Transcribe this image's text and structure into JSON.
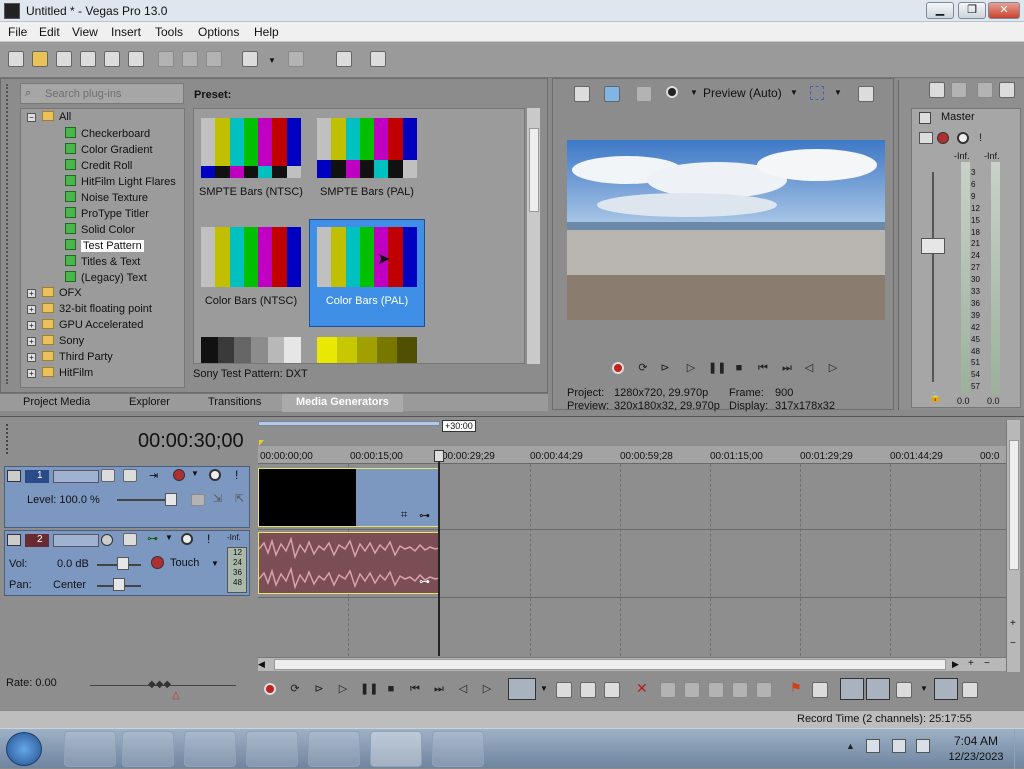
{
  "window": {
    "title": "Untitled * - Vegas Pro 13.0",
    "min": "▁",
    "max": "❐",
    "close": "✕"
  },
  "menu": [
    "File",
    "Edit",
    "View",
    "Insert",
    "Tools",
    "Options",
    "Help"
  ],
  "toolbar_icons": [
    "new-icon",
    "open-icon",
    "save-icon",
    "save-as-icon",
    "render-icon",
    "properties-icon",
    "cut-icon",
    "copy-icon",
    "paste-icon",
    "undo-icon",
    "redo-icon",
    "clean-icon",
    "help-icon"
  ],
  "plugins": {
    "search_placeholder": "Search plug-ins",
    "preset_label": "Preset:",
    "tree_root": "All",
    "generators": [
      "Checkerboard",
      "Color Gradient",
      "Credit Roll",
      "HitFilm Light Flares",
      "Noise Texture",
      "ProType Titler",
      "Solid Color",
      "Test Pattern",
      "Titles & Text",
      "(Legacy) Text"
    ],
    "folders": [
      "OFX",
      "32-bit floating point",
      "GPU Accelerated",
      "Sony",
      "Third Party",
      "HitFilm"
    ],
    "selected_generator": "Test Pattern"
  },
  "presets": [
    {
      "label": "SMPTE Bars (NTSC)"
    },
    {
      "label": "SMPTE Bars (PAL)"
    },
    {
      "label": "Color Bars (NTSC)"
    },
    {
      "label": "Color Bars (PAL)",
      "selected": true
    }
  ],
  "preset_status": "Sony Test Pattern: DXT",
  "tabs": [
    {
      "label": "Project Media"
    },
    {
      "label": "Explorer"
    },
    {
      "label": "Transitions"
    },
    {
      "label": "Media Generators",
      "active": true
    }
  ],
  "preview": {
    "mode": "Preview (Auto)",
    "project_label": "Project:",
    "project_value": "1280x720, 29.970p",
    "preview_label": "Preview:",
    "preview_value": "320x180x32, 29.970p",
    "frame_label": "Frame:",
    "frame_value": "900",
    "display_label": "Display:",
    "display_value": "317x178x32"
  },
  "master": {
    "label": "Master",
    "left_peak": "-Inf.",
    "right_peak": "-Inf.",
    "scale": [
      "3",
      "6",
      "9",
      "12",
      "15",
      "18",
      "21",
      "24",
      "27",
      "30",
      "33",
      "36",
      "39",
      "42",
      "45",
      "48",
      "51",
      "54",
      "57"
    ],
    "left_value": "0.0",
    "right_value": "0.0"
  },
  "timeline": {
    "timecode": "00:00:30;00",
    "loop_region": "+30:00",
    "ruler": [
      "00:00:00;00",
      "00:00:15;00",
      "00:00:29;29",
      "00:00:44;29",
      "00:00:59;28",
      "00:01:15;00",
      "00:01:29;29",
      "00:01:44;29",
      "00:0"
    ]
  },
  "video_track": {
    "number": "1",
    "level_label": "Level: 100.0 %"
  },
  "audio_track": {
    "number": "2",
    "vol_label": "Vol:",
    "vol_value": "0.0 dB",
    "pan_label": "Pan:",
    "pan_value": "Center",
    "automation": "Touch",
    "meter_peak": "-Inf.",
    "meter_scale": [
      "12",
      "24",
      "36",
      "48"
    ]
  },
  "rate": "Rate: 0.00",
  "status": "Record Time (2 channels): 25:17:55",
  "taskbar": {
    "time": "7:04 AM",
    "date": "12/23/2023"
  },
  "colors": {
    "bars_main": [
      "#c0c0c0",
      "#c0c000",
      "#00c0c0",
      "#00c000",
      "#c000c0",
      "#c00000",
      "#0000c0"
    ],
    "bars_ntsc_bottom": [
      "#0000c0",
      "#111111",
      "#c000c0",
      "#111111",
      "#00c0c0",
      "#111111",
      "#c0c0c0"
    ],
    "bars_pal_bottom": [
      "#0000c0",
      "#111111",
      "#c000c0",
      "#111111",
      "#00c0c0",
      "#111111",
      "#c0c0c0"
    ],
    "grey_ramp": [
      "#111111",
      "#3a3a3a",
      "#666666",
      "#8c8c8c",
      "#b8b8b8",
      "#e6e6e6"
    ],
    "yellow_ramp": [
      "#e8e800",
      "#c8c800",
      "#a0a000",
      "#787800",
      "#505000"
    ],
    "video_event": "#000000",
    "audio_event": "#7b4d55",
    "selection": "#3f8fe6"
  }
}
